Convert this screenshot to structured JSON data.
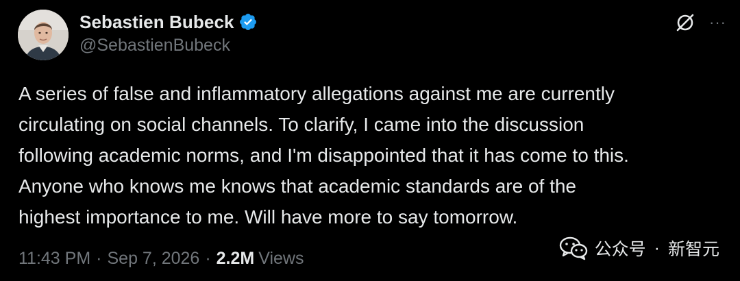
{
  "author": {
    "display_name": "Sebastien Bubeck",
    "handle": "@SebastienBubeck",
    "verified": true
  },
  "icons": {
    "verified": "verified-badge-icon",
    "grok": "grok-icon",
    "more": "more-icon",
    "watermark_logo": "wechat-icon"
  },
  "tweet": {
    "text": "A series of false and inflammatory allegations against me are currently\ncirculating on social channels. To clarify, I came into the discussion\nfollowing academic norms, and I'm disappointed that it has come to this.\nAnyone who knows me knows that academic standards are of the\nhighest importance to me. Will have more to say tomorrow."
  },
  "meta": {
    "time": "11:43 PM",
    "separator": "·",
    "date": "Sep 7, 2026",
    "views_count": "2.2M",
    "views_label": "Views"
  },
  "watermark": {
    "account_label": "公众号",
    "dot": "·",
    "name": "新智元"
  },
  "more_glyph": "···",
  "colors": {
    "background": "#000000",
    "primary_text": "#e7e9ea",
    "secondary_text": "#71767b",
    "verified_blue": "#1d9bf0"
  }
}
